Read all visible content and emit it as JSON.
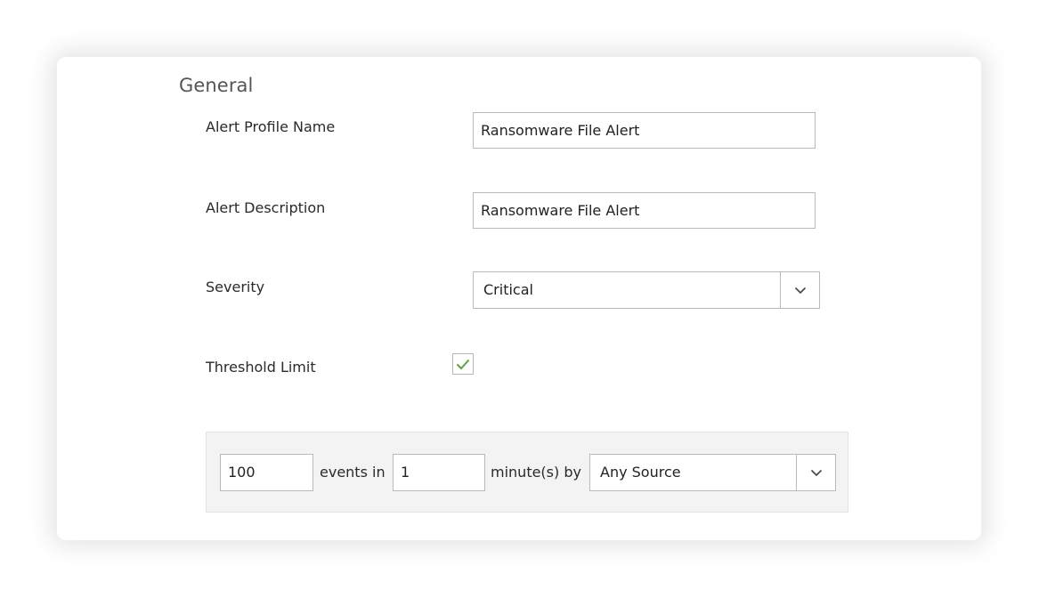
{
  "section": {
    "title": "General"
  },
  "fields": {
    "profile_name": {
      "label": "Alert Profile Name",
      "value": "Ransomware File Alert"
    },
    "description": {
      "label": "Alert Description",
      "value": "Ransomware File Alert"
    },
    "severity": {
      "label": "Severity",
      "selected": "Critical"
    },
    "threshold": {
      "label": "Threshold Limit",
      "checked": true
    }
  },
  "threshold_rule": {
    "count": "100",
    "events_in_label": "events in",
    "minutes": "1",
    "minutes_by_label": "minute(s) by",
    "source_selected": "Any Source"
  },
  "colors": {
    "check_mark": "#5fa43a",
    "border": "#b9b9b9",
    "panel_bg": "#f3f3f3"
  },
  "icons": {
    "dropdown": "chevron-down-icon",
    "checkbox": "check-icon"
  }
}
